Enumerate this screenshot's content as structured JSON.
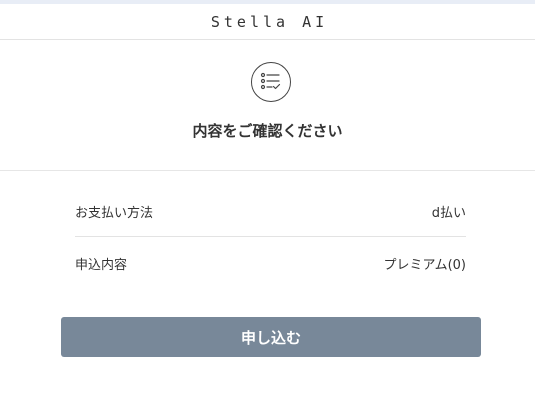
{
  "header": {
    "brand": "Stella AI"
  },
  "confirm": {
    "icon": "checklist-icon",
    "title": "内容をご確認ください"
  },
  "details": {
    "rows": [
      {
        "label": "お支払い方法",
        "value": "d払い"
      },
      {
        "label": "申込内容",
        "value": "プレミアム(0)"
      }
    ]
  },
  "actions": {
    "submit_label": "申し込む"
  },
  "colors": {
    "top_strip": "#e8edf6",
    "button_bg": "#788899",
    "divider": "#e3e3e3"
  }
}
